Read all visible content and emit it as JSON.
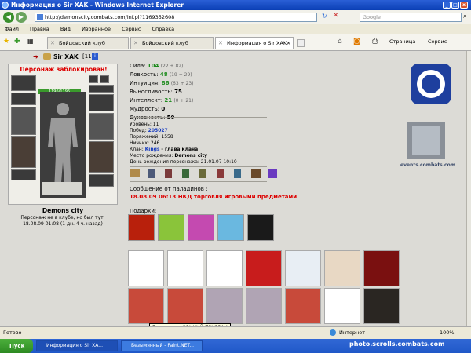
{
  "window": {
    "title": "Информация о Sir XAK - Windows Internet Explorer"
  },
  "address": {
    "url": "http://demonscity.combats.com/inf.pl?1169352608",
    "search_placeholder": "Google"
  },
  "menu": [
    "Файл",
    "Правка",
    "Вид",
    "Избранное",
    "Сервис",
    "Справка"
  ],
  "tabs": [
    {
      "label": "Бойцовский клуб"
    },
    {
      "label": "Бойцовский клуб"
    },
    {
      "label": "Информация о Sir XAK"
    }
  ],
  "toolbar": {
    "page_label": "Страница",
    "service_label": "Сервис"
  },
  "character": {
    "name": "Sir XAK",
    "level": "[11]",
    "blocked": "Персонаж заблокирован!",
    "hp": "1196/1196",
    "city": "Demons city",
    "absent_line1": "Персонаж не в клубе, но был тут:",
    "absent_line2": "18.08.09 01:08 (1 дн. 4 ч. назад)"
  },
  "stats": [
    {
      "label": "Сила:",
      "value": "104",
      "extra": "(22 + 82)"
    },
    {
      "label": "Ловкость:",
      "value": "48",
      "extra": "(19 + 29)"
    },
    {
      "label": "Интуиция:",
      "value": "86",
      "extra": "(63 + 23)"
    },
    {
      "label": "Выносливость:",
      "value": "75",
      "extra": ""
    },
    {
      "label": "Интеллект:",
      "value": "21",
      "extra": "(0 + 21)"
    },
    {
      "label": "Мудрость:",
      "value": "0",
      "extra": ""
    },
    {
      "label": "Духовность:",
      "value": "50",
      "extra": ""
    }
  ],
  "info": {
    "level": "Уровень: 11",
    "wins_label": "Побед:",
    "wins": "205027",
    "losses": "Поражений: 1558",
    "draws": "Ничьих: 246",
    "clan_label": "Клан:",
    "clan": "Kings",
    "clan_role": "- глава клана",
    "birthplace_label": "Место рождения:",
    "birthplace": "Demons city",
    "birthday": "День рождения персонажа: 21.01.07 10:10"
  },
  "paladin": {
    "label": "Сообщение от паладинов :",
    "message": "18.08.09 06:13 НКД торговля игровыми предметами"
  },
  "gifts_label": "Подарки:",
  "tooltip": "Подарок от СОННИЙ-ПРИЗРАК",
  "emblem_caption": "events.combats.com",
  "status": {
    "left": "Готово",
    "zone": "Интернет",
    "zoom": "100%"
  },
  "taskbar": {
    "start": "Пуск",
    "items": [
      "Информация о Sir XA...",
      "Безымянный - Paint.NET..."
    ],
    "watermark": "photo.scrolls.combats.com"
  }
}
